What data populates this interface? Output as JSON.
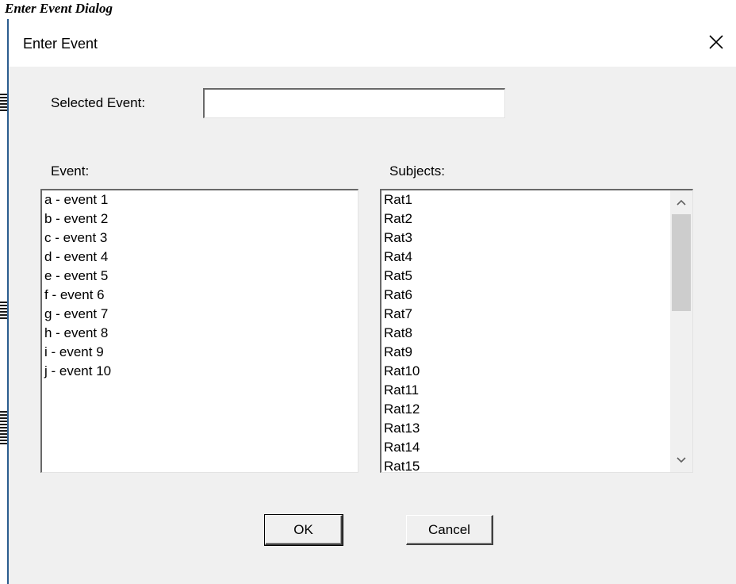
{
  "caption": "Enter Event Dialog",
  "window": {
    "title": "Enter Event",
    "close_icon": "close-icon"
  },
  "selected_event": {
    "label": "Selected Event:",
    "value": "",
    "placeholder": ""
  },
  "events": {
    "label": "Event:",
    "items": [
      "a - event 1",
      "b - event 2",
      "c - event 3",
      "d - event 4",
      "e - event 5",
      "f - event 6",
      "g - event 7",
      "h - event 8",
      "i - event 9",
      "j - event 10"
    ]
  },
  "subjects": {
    "label": "Subjects:",
    "items": [
      "Rat1",
      "Rat2",
      "Rat3",
      "Rat4",
      "Rat5",
      "Rat6",
      "Rat7",
      "Rat8",
      "Rat9",
      "Rat10",
      "Rat11",
      "Rat12",
      "Rat13",
      "Rat14",
      "Rat15"
    ],
    "scroll_up_icon": "chevron-up-icon",
    "scroll_down_icon": "chevron-down-icon"
  },
  "buttons": {
    "ok_label": "OK",
    "cancel_label": "Cancel"
  },
  "colors": {
    "dialog_background": "#f0f0f0",
    "title_background": "#ffffff",
    "window_edge": "#2c5d8f"
  }
}
